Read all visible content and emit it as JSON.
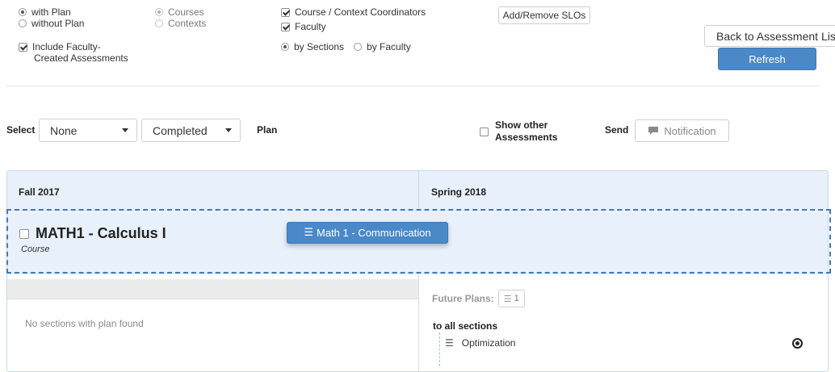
{
  "filters": {
    "plan_options": [
      {
        "label": "with Plan",
        "selected": true
      },
      {
        "label": "without Plan",
        "selected": false
      }
    ],
    "include_faculty_line1": "Include Faculty-",
    "include_faculty_line2": "Created Assessments",
    "scope_options": [
      {
        "label": "Courses",
        "selected": true
      },
      {
        "label": "Contexts",
        "selected": false
      }
    ],
    "role_checks": [
      {
        "label": "Course / Context Coordinators",
        "checked": true
      },
      {
        "label": "Faculty",
        "checked": true
      }
    ],
    "group_options": [
      {
        "label": "by Sections",
        "selected": true
      },
      {
        "label": "by Faculty",
        "selected": false
      }
    ],
    "add_remove_slos": "Add/Remove SLOs",
    "back_button": "Back to Assessment List",
    "refresh_button": "Refresh"
  },
  "toolbar": {
    "select_label": "Select",
    "select_value": "None",
    "status_value": "Completed",
    "plan_label": "Plan",
    "show_other_line1": "Show other",
    "show_other_line2": "Assessments",
    "send_label": "Send",
    "notification_button": "Notification"
  },
  "grid": {
    "columns": [
      "Fall 2017",
      "Spring 2018"
    ],
    "course": {
      "title": "MATH1 - Calculus I",
      "type": "Course",
      "plan_chip": "Math 1 - Communication"
    },
    "left_empty": "No sections with plan found",
    "future_plans_label": "Future Plans:",
    "future_plans_count": "1",
    "to_all_sections": "to all sections",
    "plan_item": "Optimization"
  },
  "colors": {
    "primary": "#4a88c7",
    "panel_header": "#e8f0fb",
    "dashed_border": "#3b7bbf"
  }
}
